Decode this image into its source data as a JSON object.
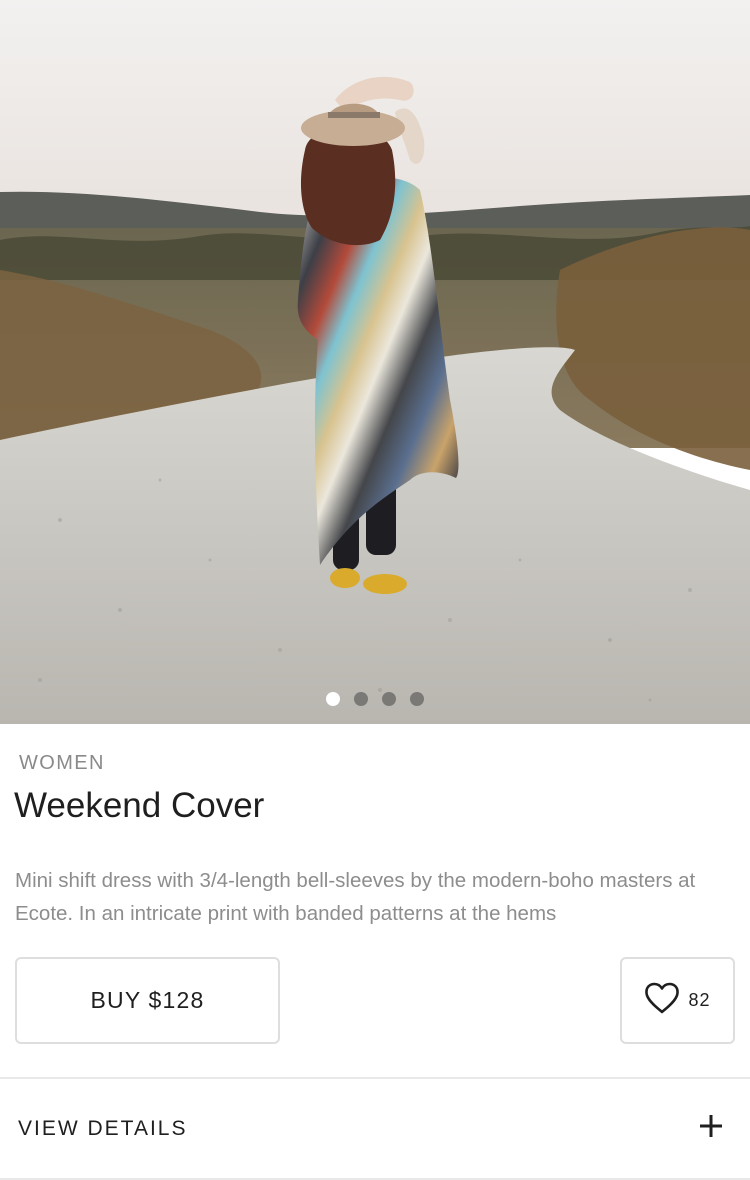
{
  "product": {
    "category": "WOMEN",
    "title": "Weekend Cover",
    "description": "Mini shift dress with 3/4-length bell-sleeves by the modern-boho masters at Ecote. In an intricate print with banded patterns at the hems"
  },
  "gallery": {
    "image_subject": "woman-walking-gravel-road-photo",
    "slide_count": 4,
    "active_slide": 1
  },
  "actions": {
    "buy_label": "BUY $128",
    "like_count": "82",
    "like_icon": "heart-outline-icon"
  },
  "details": {
    "label": "VIEW DETAILS",
    "expand_icon": "plus-icon"
  },
  "colors": {
    "border": "#dedede",
    "text_primary": "#1f1f1f",
    "text_secondary": "#8d8d8d",
    "dot_active": "#ffffff"
  }
}
